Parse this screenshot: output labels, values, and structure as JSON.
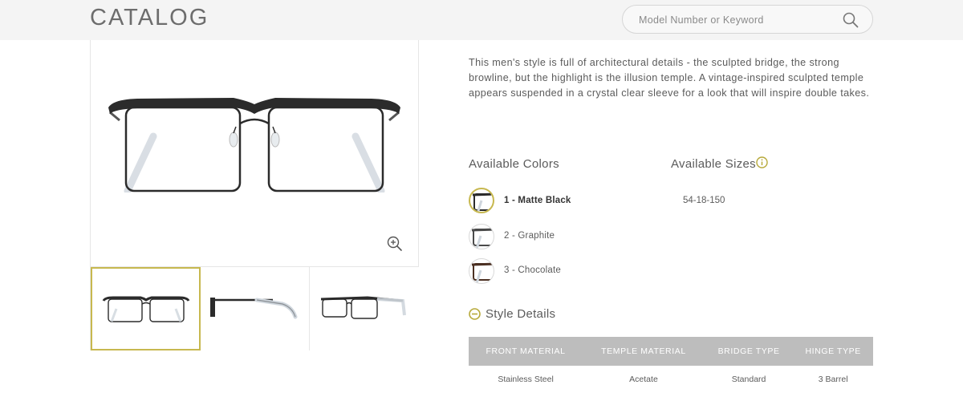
{
  "header": {
    "brand": "CATALOG",
    "search_placeholder": "Model Number or Keyword",
    "search_icon": "search-icon"
  },
  "product": {
    "description": "This men's style is full of architectural details - the sculpted bridge, the strong browline, but the highlight is the illusion temple. A vintage-inspired sculpted temple appears suspended in a crystal clear sleeve for a look that will inspire double takes.",
    "colors_title": "Available Colors",
    "sizes_title": "Available Sizes",
    "colors": [
      {
        "label": "1 - Matte Black",
        "selected": true,
        "frame_color": "#2b2b2b"
      },
      {
        "label": "2 - Graphite",
        "selected": false,
        "frame_color": "#4a4a4a"
      },
      {
        "label": "3 - Chocolate",
        "selected": false,
        "frame_color": "#4b3022"
      }
    ],
    "sizes": [
      "54-18-150"
    ],
    "style_details_title": "Style Details",
    "details_table": {
      "headers": [
        "FRONT MATERIAL",
        "TEMPLE MATERIAL",
        "BRIDGE TYPE",
        "HINGE TYPE"
      ],
      "values": [
        "Stainless Steel",
        "Acetate",
        "Standard",
        "3 Barrel"
      ]
    }
  },
  "colors": {
    "accent": "#c7b84f",
    "table_header_bg": "#bdbdbd",
    "header_bg": "#f4f4f4"
  }
}
